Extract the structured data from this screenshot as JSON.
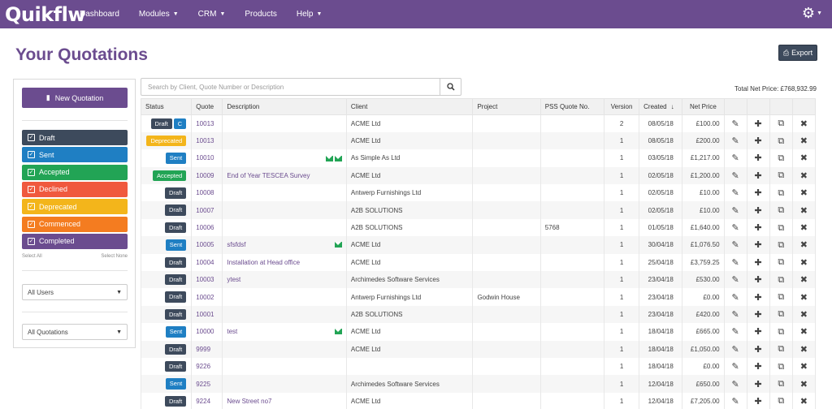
{
  "app": {
    "logo": "Quikflw"
  },
  "nav": [
    {
      "label": "Dashboard",
      "caret": false
    },
    {
      "label": "Modules",
      "caret": true
    },
    {
      "label": "CRM",
      "caret": true
    },
    {
      "label": "Products",
      "caret": false
    },
    {
      "label": "Help",
      "caret": true
    }
  ],
  "header": {
    "title": "Your Quotations",
    "export_label": "Export"
  },
  "sidebar": {
    "new_quotation": "New Quotation",
    "statuses": [
      {
        "label": "Draft",
        "color": "#3d4a5c"
      },
      {
        "label": "Sent",
        "color": "#1f7fc3"
      },
      {
        "label": "Accepted",
        "color": "#22a455"
      },
      {
        "label": "Declined",
        "color": "#f0593e"
      },
      {
        "label": "Deprecated",
        "color": "#f3b51b"
      },
      {
        "label": "Commenced",
        "color": "#f47c20"
      },
      {
        "label": "Completed",
        "color": "#6b4c8f"
      }
    ],
    "select_all": "Select All",
    "select_none": "Select None",
    "users_dropdown": "All Users",
    "quotations_dropdown": "All Quotations"
  },
  "search": {
    "placeholder": "Search by Client, Quote Number or Description"
  },
  "total": "Total Net Price: £768,932.99",
  "table": {
    "columns": [
      "Status",
      "Quote",
      "Description",
      "Client",
      "Project",
      "PSS Quote No.",
      "Version",
      "Created",
      "Net Price"
    ],
    "sort_indicator": "↓",
    "rows": [
      {
        "status": "Draft",
        "extra_badge": "C",
        "quote": "10013",
        "description": "",
        "mail": 0,
        "client": "ACME Ltd",
        "project": "",
        "pss": "",
        "version": "2",
        "created": "08/05/18",
        "net": "£100.00"
      },
      {
        "status": "Deprecated",
        "extra_badge": "",
        "quote": "10013",
        "description": "",
        "mail": 0,
        "client": "ACME Ltd",
        "project": "",
        "pss": "",
        "version": "1",
        "created": "08/05/18",
        "net": "£200.00"
      },
      {
        "status": "Sent",
        "extra_badge": "",
        "quote": "10010",
        "description": "",
        "mail": 2,
        "client": "As Simple As Ltd",
        "project": "",
        "pss": "",
        "version": "1",
        "created": "03/05/18",
        "net": "£1,217.00"
      },
      {
        "status": "Accepted",
        "extra_badge": "",
        "quote": "10009",
        "description": "End of Year TESCEA Survey",
        "mail": 0,
        "client": "ACME Ltd",
        "project": "",
        "pss": "",
        "version": "1",
        "created": "02/05/18",
        "net": "£1,200.00"
      },
      {
        "status": "Draft",
        "extra_badge": "",
        "quote": "10008",
        "description": "",
        "mail": 0,
        "client": "Antwerp Furnishings Ltd",
        "project": "",
        "pss": "",
        "version": "1",
        "created": "02/05/18",
        "net": "£10.00"
      },
      {
        "status": "Draft",
        "extra_badge": "",
        "quote": "10007",
        "description": "",
        "mail": 0,
        "client": "A2B SOLUTIONS",
        "project": "",
        "pss": "",
        "version": "1",
        "created": "02/05/18",
        "net": "£10.00"
      },
      {
        "status": "Draft",
        "extra_badge": "",
        "quote": "10006",
        "description": "",
        "mail": 0,
        "client": "A2B SOLUTIONS",
        "project": "",
        "pss": "5768",
        "version": "1",
        "created": "01/05/18",
        "net": "£1,640.00"
      },
      {
        "status": "Sent",
        "extra_badge": "",
        "quote": "10005",
        "description": "sfsfdsf",
        "mail": 1,
        "client": "ACME Ltd",
        "project": "",
        "pss": "",
        "version": "1",
        "created": "30/04/18",
        "net": "£1,076.50"
      },
      {
        "status": "Draft",
        "extra_badge": "",
        "quote": "10004",
        "description": "Installation at Head office",
        "mail": 0,
        "client": "ACME Ltd",
        "project": "",
        "pss": "",
        "version": "1",
        "created": "25/04/18",
        "net": "£3,759.25"
      },
      {
        "status": "Draft",
        "extra_badge": "",
        "quote": "10003",
        "description": "ytest",
        "mail": 0,
        "client": "Archimedes Software Services",
        "project": "",
        "pss": "",
        "version": "1",
        "created": "23/04/18",
        "net": "£530.00"
      },
      {
        "status": "Draft",
        "extra_badge": "",
        "quote": "10002",
        "description": "",
        "mail": 0,
        "client": "Antwerp Furnishings Ltd",
        "project": "Godwin House",
        "pss": "",
        "version": "1",
        "created": "23/04/18",
        "net": "£0.00"
      },
      {
        "status": "Draft",
        "extra_badge": "",
        "quote": "10001",
        "description": "",
        "mail": 0,
        "client": "A2B SOLUTIONS",
        "project": "",
        "pss": "",
        "version": "1",
        "created": "23/04/18",
        "net": "£420.00"
      },
      {
        "status": "Sent",
        "extra_badge": "",
        "quote": "10000",
        "description": "test",
        "mail": 1,
        "client": "ACME Ltd",
        "project": "",
        "pss": "",
        "version": "1",
        "created": "18/04/18",
        "net": "£665.00"
      },
      {
        "status": "Draft",
        "extra_badge": "",
        "quote": "9999",
        "description": "",
        "mail": 0,
        "client": "ACME Ltd",
        "project": "",
        "pss": "",
        "version": "1",
        "created": "18/04/18",
        "net": "£1,050.00"
      },
      {
        "status": "Draft",
        "extra_badge": "",
        "quote": "9226",
        "description": "",
        "mail": 0,
        "client": "",
        "project": "",
        "pss": "",
        "version": "1",
        "created": "18/04/18",
        "net": "£0.00"
      },
      {
        "status": "Sent",
        "extra_badge": "",
        "quote": "9225",
        "description": "",
        "mail": 0,
        "client": "Archimedes Software Services",
        "project": "",
        "pss": "",
        "version": "1",
        "created": "12/04/18",
        "net": "£650.00"
      },
      {
        "status": "Draft",
        "extra_badge": "",
        "quote": "9224",
        "description": "New Street no7",
        "mail": 0,
        "client": "ACME Ltd",
        "project": "",
        "pss": "",
        "version": "1",
        "created": "12/04/18",
        "net": "£7,205.00"
      }
    ]
  }
}
